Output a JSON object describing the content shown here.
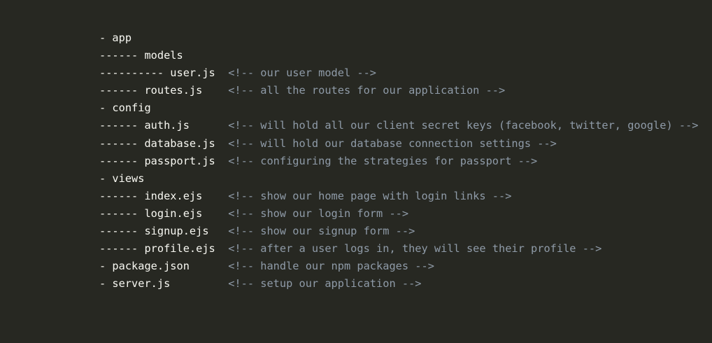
{
  "code_block": {
    "lines": [
      {
        "code": "- app",
        "comment": ""
      },
      {
        "code": "------ models",
        "comment": ""
      },
      {
        "code": "---------- user.js  ",
        "comment": "<!-- our user model -->"
      },
      {
        "code": "------ routes.js    ",
        "comment": "<!-- all the routes for our application -->"
      },
      {
        "code": "- config",
        "comment": ""
      },
      {
        "code": "------ auth.js      ",
        "comment": "<!-- will hold all our client secret keys (facebook, twitter, google) -->"
      },
      {
        "code": "------ database.js  ",
        "comment": "<!-- will hold our database connection settings -->"
      },
      {
        "code": "------ passport.js  ",
        "comment": "<!-- configuring the strategies for passport -->"
      },
      {
        "code": "- views",
        "comment": ""
      },
      {
        "code": "------ index.ejs    ",
        "comment": "<!-- show our home page with login links -->"
      },
      {
        "code": "------ login.ejs    ",
        "comment": "<!-- show our login form -->"
      },
      {
        "code": "------ signup.ejs   ",
        "comment": "<!-- show our signup form -->"
      },
      {
        "code": "------ profile.ejs  ",
        "comment": "<!-- after a user logs in, they will see their profile -->"
      },
      {
        "code": "- package.json      ",
        "comment": "<!-- handle our npm packages -->"
      },
      {
        "code": "- server.js         ",
        "comment": "<!-- setup our application -->"
      }
    ]
  }
}
